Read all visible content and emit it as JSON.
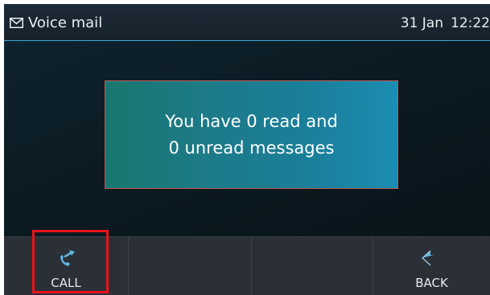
{
  "header": {
    "title": "Voice mail",
    "title_icon": "envelope-icon",
    "date": "31 Jan",
    "time": "12:22"
  },
  "dialog": {
    "line1": "You have 0 read and",
    "line2": "0 unread messages"
  },
  "softkeys": [
    {
      "label": "CALL",
      "icon": "call-icon"
    },
    {
      "label": "",
      "icon": ""
    },
    {
      "label": "",
      "icon": ""
    },
    {
      "label": "BACK",
      "icon": "back-arrow-icon"
    }
  ],
  "colors": {
    "accent": "#3aa6d6",
    "dialog": "#1a7f9a",
    "highlight": "#e8141b"
  }
}
